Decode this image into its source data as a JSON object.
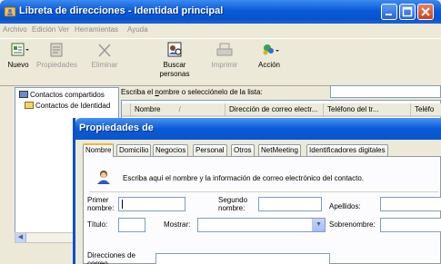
{
  "window": {
    "title": "Libreta de direcciones - Identidad principal"
  },
  "menu": [
    "Archivo",
    "Edición",
    "Ver",
    "Herramientas",
    "Ayuda"
  ],
  "toolbar": {
    "nuevo": "Nuevo",
    "propiedades": "Propiedades",
    "eliminar": "Eliminar",
    "buscar_1": "Buscar",
    "buscar_2": "personas",
    "imprimir": "Imprimir",
    "accion": "Acción"
  },
  "tree": {
    "item1": "Contactos compartidos",
    "item2": "Contactos de Identidad"
  },
  "search": {
    "label_before": "Escriba el ",
    "label_underlined": "n",
    "label_after": "ombre o selecciónelo de la lista:",
    "value": ""
  },
  "list": {
    "columns": [
      "Nombre",
      "/",
      "Dirección de correo electr...",
      "Teléfono del tr...",
      "Teléfo"
    ]
  },
  "dialog": {
    "title": "Propiedades de",
    "tabs": [
      "Nombre",
      "Domicilio",
      "Negocios",
      "Personal",
      "Otros",
      "NetMeeting",
      "Identificadores digitales"
    ],
    "info": "Escriba aquí el nombre y la información de correo electrónico del contacto.",
    "primer_1": "Primer",
    "primer_2": "nombre:",
    "segundo_1": "Segundo",
    "segundo_2": "nombre:",
    "apellidos": "Apellidos:",
    "titulo": "Título:",
    "mostrar": "Mostrar:",
    "sobrenombre": "Sobrenombre:",
    "direcciones_1": "Direcciones de",
    "direcciones_2": "correo"
  },
  "colors": {
    "titlebar": "#0a5ad8",
    "active_tab_accent": "#f4b63f",
    "face": "#ece9d8"
  }
}
